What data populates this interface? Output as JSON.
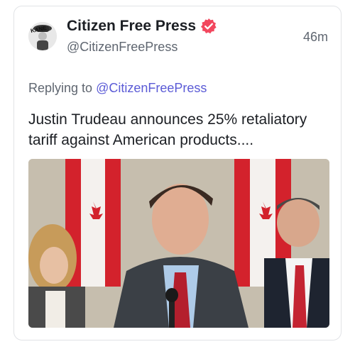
{
  "post": {
    "author_name": "Citizen Free Press",
    "handle": "@CitizenFreePress",
    "timestamp": "46m",
    "avatar_text": "KANE",
    "replying_prefix": "Replying to",
    "replying_handle": "@CitizenFreePress",
    "text": "Justin Trudeau announces 25% retaliatory tariff against American products....",
    "icons": {
      "verified": "verified-badge-icon"
    },
    "colors": {
      "verified_badge": "#f2475e",
      "link": "#5b5bd6",
      "text": "#1c1f24",
      "secondary": "#5f6670"
    }
  }
}
